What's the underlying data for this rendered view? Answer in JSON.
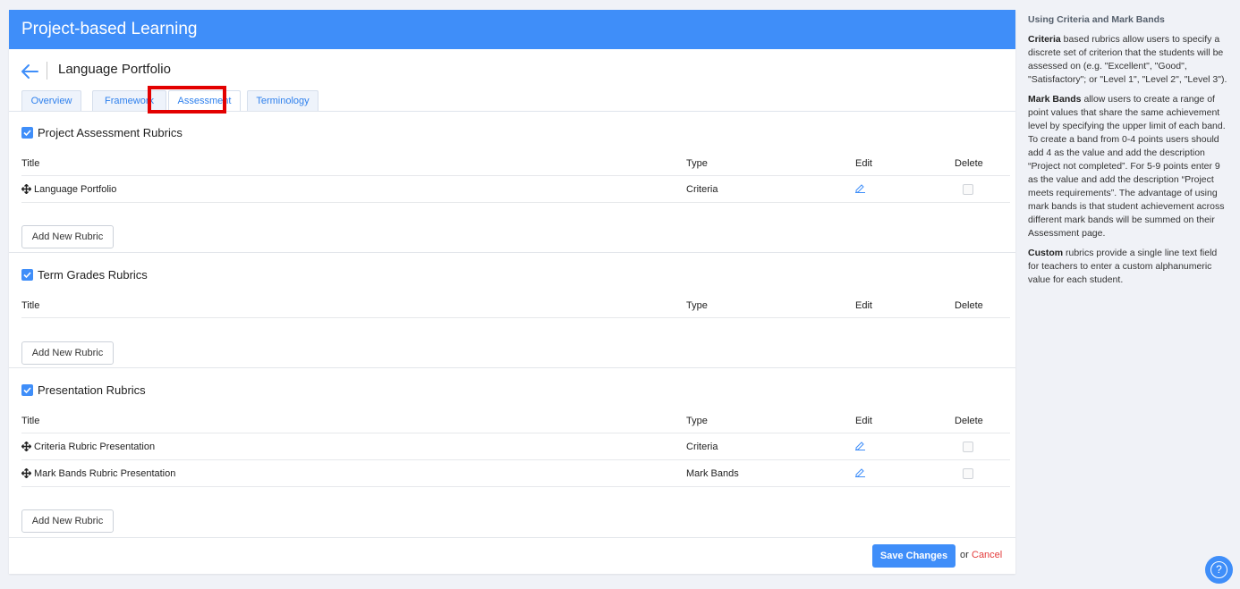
{
  "header": {
    "title": "Project-based Learning"
  },
  "page": {
    "title": "Language Portfolio"
  },
  "tabs": [
    {
      "label": "Overview"
    },
    {
      "label": "Framework"
    },
    {
      "label": "Assessment",
      "active": true
    },
    {
      "label": "Terminology"
    }
  ],
  "columns": {
    "title": "Title",
    "type": "Type",
    "edit": "Edit",
    "delete": "Delete"
  },
  "sections": [
    {
      "label": "Project Assessment Rubrics",
      "checked": true,
      "rows": [
        {
          "title": "Language Portfolio",
          "type": "Criteria"
        }
      ],
      "add_label": "Add New Rubric"
    },
    {
      "label": "Term Grades Rubrics",
      "checked": true,
      "rows": [],
      "add_label": "Add New Rubric"
    },
    {
      "label": "Presentation Rubrics",
      "checked": true,
      "rows": [
        {
          "title": "Criteria Rubric Presentation",
          "type": "Criteria"
        },
        {
          "title": "Mark Bands Rubric Presentation",
          "type": "Mark Bands"
        }
      ],
      "add_label": "Add New Rubric"
    }
  ],
  "footer": {
    "save_label": "Save Changes",
    "or_text": "or",
    "cancel_label": "Cancel"
  },
  "help": {
    "heading": "Using Criteria and Mark Bands",
    "criteria_term": "Criteria",
    "criteria_text": " based rubrics allow users to specify a discrete set of criterion that the students will be assessed on (e.g. \"Excellent\", \"Good\", \"Satisfactory\"; or \"Level 1\", \"Level 2\", \"Level 3\").",
    "markbands_term": "Mark Bands",
    "markbands_text": " allow users to create a range of point values that share the same achievement level by specifying the upper limit of each band. To create a band from 0-4 points users should add 4 as the value and add the description “Project not completed”. For 5-9 points enter 9 as the value and add the description “Project meets requirements”. The advantage of using mark bands is that student achievement across different mark bands will be summed on their Assessment page.",
    "custom_term": "Custom",
    "custom_text": " rubrics provide a single line text field for teachers to enter a custom alphanumeric value for each student."
  },
  "help_button": {
    "glyph": "?"
  },
  "colors": {
    "primary": "#3f8ef9",
    "cancel": "#e33b3b",
    "highlight": "#e30000"
  }
}
